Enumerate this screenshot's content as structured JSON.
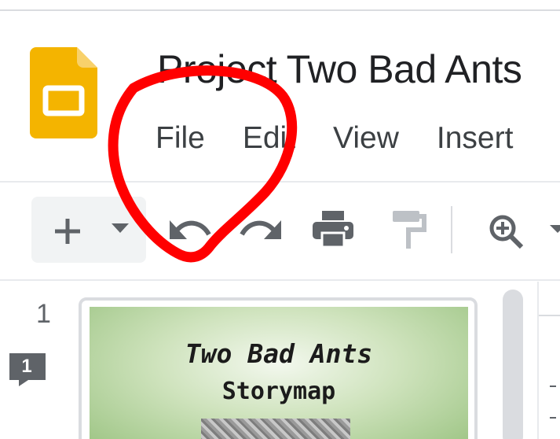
{
  "header": {
    "doc_title": "Project Two Bad Ants",
    "menu": [
      "File",
      "Edit",
      "View",
      "Insert"
    ]
  },
  "toolbar": {
    "icons": [
      "plus-icon",
      "caret-down-icon",
      "undo-icon",
      "redo-icon",
      "print-icon",
      "paint-format-icon",
      "zoom-icon",
      "zoom-caret-icon"
    ]
  },
  "filmstrip": {
    "slide_number": "1",
    "comment_count": "1",
    "slide_title": "Two Bad Ants",
    "slide_subtitle": "Storymap"
  },
  "colors": {
    "logo_yellow": "#F4B400",
    "annotation_red": "#FF0000",
    "icon_gray": "#5f6368"
  }
}
